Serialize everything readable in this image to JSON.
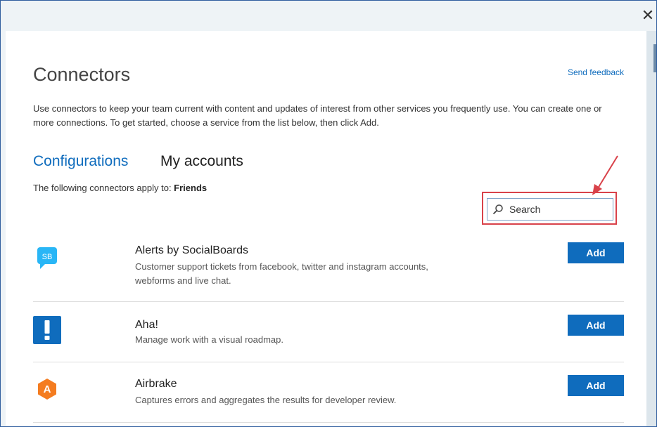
{
  "dialog": {
    "title": "Connectors",
    "send_feedback": "Send feedback",
    "description": "Use connectors to keep your team current with content and updates of interest from other services you frequently use. You can create one or more connections. To get started, choose a service from the list below, then click Add.",
    "close_glyph": "✕"
  },
  "tabs": [
    {
      "label": "Configurations",
      "active": true
    },
    {
      "label": "My accounts",
      "active": false
    }
  ],
  "applies": {
    "prefix": "The following connectors apply to: ",
    "team": "Friends"
  },
  "search": {
    "placeholder": "Search",
    "value": ""
  },
  "connectors": [
    {
      "name": "Alerts by SocialBoards",
      "description": "Customer support tickets from facebook, twitter and instagram accounts, webforms and live chat.",
      "logo_text": "SB",
      "logo_icon": "socialboards-logo",
      "button_label": "Add"
    },
    {
      "name": "Aha!",
      "description": "Manage work with a visual roadmap.",
      "logo_text": "",
      "logo_icon": "aha-logo",
      "button_label": "Add"
    },
    {
      "name": "Airbrake",
      "description": "Captures errors and aggregates the results for developer review.",
      "logo_text": "A",
      "logo_icon": "airbrake-logo",
      "button_label": "Add"
    }
  ],
  "colors": {
    "accent": "#0f6cbd",
    "highlight_box": "#d9424a",
    "socialboards": "#29b6f6",
    "aha": "#0f6cbd",
    "airbrake": "#f47c20"
  }
}
